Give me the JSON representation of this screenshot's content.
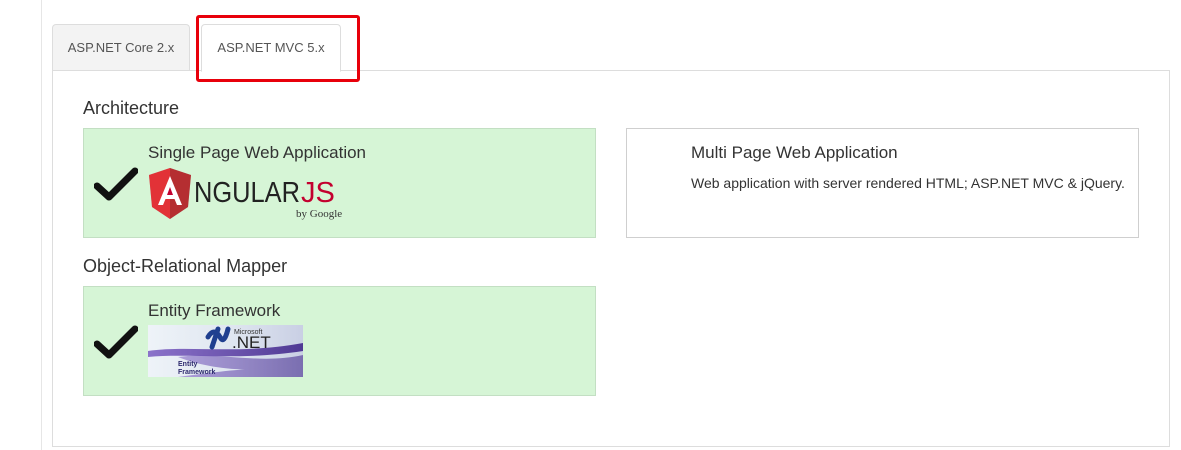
{
  "tabs": [
    {
      "label": "ASP.NET Core 2.x",
      "selected": false
    },
    {
      "label": "ASP.NET MVC 5.x",
      "selected": true
    }
  ],
  "highlight_color": "#e8000b",
  "selected_color": "#d6f5d6",
  "architecture": {
    "title": "Architecture",
    "options": [
      {
        "title": "Single Page Web Application",
        "selected": true,
        "logo": "angularjs-logo",
        "logo_text": {
          "main": "NGULAR",
          "js": "JS",
          "by": "by Google"
        }
      },
      {
        "title": "Multi Page Web Application",
        "selected": false,
        "description": "Web application with server rendered HTML; ASP.NET MVC & jQuery."
      }
    ]
  },
  "orm": {
    "title": "Object-Relational Mapper",
    "options": [
      {
        "title": "Entity Framework",
        "selected": true,
        "logo": "dotnet-entity-framework-logo",
        "logo_text": {
          "brand": "Microsoft",
          "net": ".NET",
          "product_line1": "Entity",
          "product_line2": "Framework"
        }
      }
    ]
  },
  "icons": {
    "check": "checkmark-icon"
  }
}
